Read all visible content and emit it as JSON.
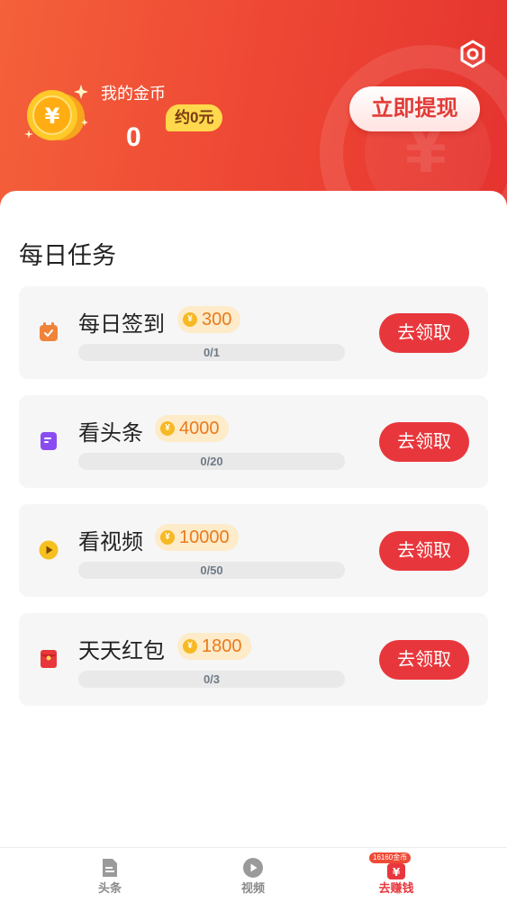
{
  "header": {
    "coin_label": "我的金币",
    "coin_value": "0",
    "approx_value": "约0元",
    "withdraw_label": "立即提现",
    "icons": [
      "settings-icon",
      "coin-stack-icon"
    ]
  },
  "section": {
    "title": "每日任务"
  },
  "tasks": [
    {
      "name": "每日签到",
      "reward": "300",
      "progress": "0/1",
      "action": "去领取",
      "icon": "calendar-icon",
      "icon_color": "#f0833a"
    },
    {
      "name": "看头条",
      "reward": "4000",
      "progress": "0/20",
      "action": "去领取",
      "icon": "article-icon",
      "icon_color": "#8a4cf0"
    },
    {
      "name": "看视频",
      "reward": "10000",
      "progress": "0/50",
      "action": "去领取",
      "icon": "play-icon",
      "icon_color": "#f6c021"
    },
    {
      "name": "天天红包",
      "reward": "1800",
      "progress": "0/3",
      "action": "去领取",
      "icon": "red-envelope-icon",
      "icon_color": "#e8373c"
    }
  ],
  "tabbar": {
    "items": [
      {
        "label": "头条",
        "icon": "article-icon",
        "active": false
      },
      {
        "label": "视频",
        "icon": "play-icon",
        "active": false
      },
      {
        "label": "去赚钱",
        "icon": "yen-icon",
        "active": true,
        "badge": "16160金币"
      }
    ]
  },
  "colors": {
    "header_start": "#f4613a",
    "header_end": "#e5332f",
    "accent": "#e8373c",
    "reward_text": "#ea7a1d",
    "reward_bg": "#fdebc9"
  }
}
